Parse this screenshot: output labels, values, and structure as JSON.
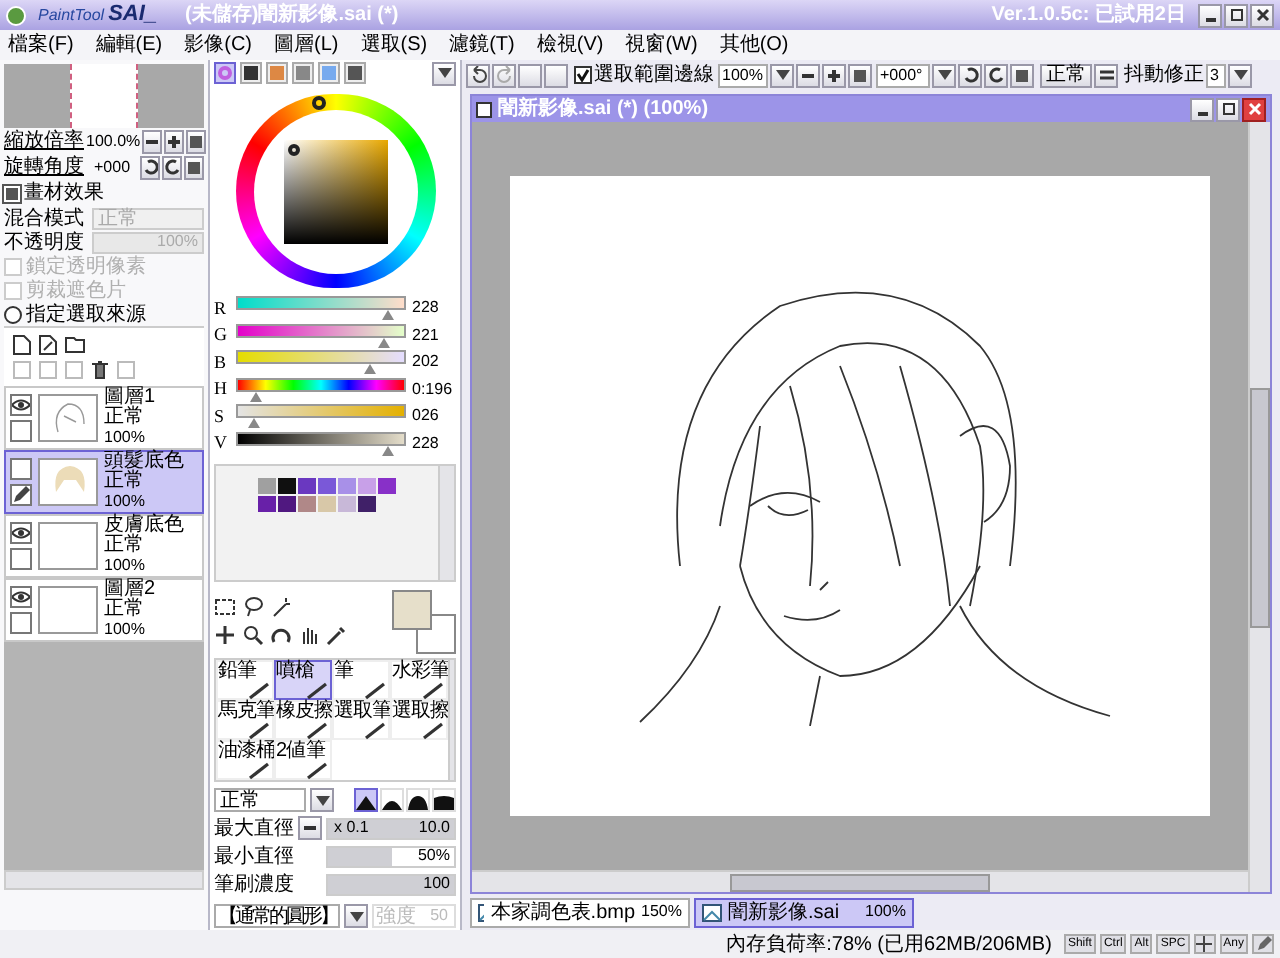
{
  "title_bar": {
    "logo": "PaintTool",
    "logo_mark": "SAI_",
    "title": "(未儲存)闇新影像.sai (*)",
    "version": "Ver.1.0.5c: 已試用2日"
  },
  "menu": [
    "檔案(F)",
    "編輯(E)",
    "影像(C)",
    "圖層(L)",
    "選取(S)",
    "濾鏡(T)",
    "檢視(V)",
    "視窗(W)",
    "其他(O)"
  ],
  "toolbar": {
    "selection_edge": {
      "label": "選取範圍邊線",
      "checked": true
    },
    "zoom": "100%",
    "angle": "+000°",
    "mode": "正常",
    "stabilizer_label": "抖動修正",
    "stabilizer": "3"
  },
  "navigator": {
    "zoom_label": "縮放倍率",
    "zoom": "100.0%",
    "angle_label": "旋轉角度",
    "angle": "+000"
  },
  "layer_properties": {
    "texture_label": "畫材效果",
    "blend_label": "混合模式",
    "blend": "正常",
    "opacity_label": "不透明度",
    "opacity": "100%",
    "options": [
      {
        "label": "鎖定透明像素",
        "kind": "checkbox",
        "checked": false,
        "disabled": true
      },
      {
        "label": "剪裁遮色片",
        "kind": "checkbox",
        "checked": false,
        "disabled": true
      },
      {
        "label": "指定選取來源",
        "kind": "radio",
        "checked": false,
        "disabled": false
      }
    ]
  },
  "layers": [
    {
      "name": "圖層1",
      "mode": "正常",
      "opacity": "100%",
      "visible": true,
      "selected": false
    },
    {
      "name": "頭髮底色",
      "mode": "正常",
      "opacity": "100%",
      "visible": false,
      "selected": true
    },
    {
      "name": "皮膚底色",
      "mode": "正常",
      "opacity": "100%",
      "visible": true,
      "selected": false
    },
    {
      "name": "圖層2",
      "mode": "正常",
      "opacity": "100%",
      "visible": true,
      "selected": false
    }
  ],
  "color_sliders": [
    {
      "label": "R",
      "kind": "r",
      "value": "228",
      "level": 0.89
    },
    {
      "label": "G",
      "kind": "g",
      "value": "221",
      "level": 0.87
    },
    {
      "label": "B",
      "kind": "b",
      "value": "202",
      "level": 0.79
    },
    {
      "label": "H",
      "kind": "h",
      "value": "0:196",
      "level": 0.12
    },
    {
      "label": "S",
      "kind": "s",
      "value": "026",
      "level": 0.1
    },
    {
      "label": "V",
      "kind": "v",
      "value": "228",
      "level": 0.89
    }
  ],
  "swatches": [
    {
      "color": "#a0a0a0"
    },
    {
      "color": "#101010"
    },
    {
      "color": "#6a38c0"
    },
    {
      "color": "#7a58d8"
    },
    {
      "color": "#a890e8"
    },
    {
      "color": "#c8a0e8"
    },
    {
      "color": "#8830c8"
    },
    {
      "color": "#6820a8"
    },
    {
      "color": "#501880"
    },
    {
      "color": "#b08888"
    },
    {
      "color": "#d8c8a8"
    },
    {
      "color": "#c8b8d8"
    },
    {
      "color": "#402068"
    }
  ],
  "tools": [
    {
      "label": "鉛筆",
      "selected": false
    },
    {
      "label": "噴槍",
      "selected": true
    },
    {
      "label": "筆",
      "selected": false
    },
    {
      "label": "水彩筆",
      "selected": false
    },
    {
      "label": "馬克筆",
      "selected": false
    },
    {
      "label": "橡皮擦",
      "selected": false
    },
    {
      "label": "選取筆",
      "selected": false
    },
    {
      "label": "選取擦",
      "selected": false
    },
    {
      "label": "油漆桶",
      "selected": false
    },
    {
      "label": "2値筆",
      "selected": false
    }
  ],
  "brush": {
    "blend": "正常",
    "tips": [
      {
        "selected": true
      },
      {
        "selected": false
      },
      {
        "selected": false
      },
      {
        "selected": false
      }
    ],
    "max_size": {
      "label": "最大直徑",
      "multiplier": "x 0.1",
      "value": "10.0",
      "level": 1
    },
    "min_size": {
      "label": "最小直徑",
      "value": "50%",
      "level": 0.5
    },
    "density": {
      "label": "筆刷濃度",
      "value": "100",
      "level": 1
    },
    "shape": "【通常的圓形】",
    "strength": {
      "label": "強度",
      "value": "50",
      "disabled": true
    }
  },
  "canvas_window": {
    "title": "闇新影像.sai (*) (100%)"
  },
  "document_tabs": [
    {
      "name": "本家調色表.bmp",
      "zoom": "150%",
      "selected": false
    },
    {
      "name": "闇新影像.sai",
      "zoom": "100%",
      "selected": true
    }
  ],
  "status_bar": {
    "memory": "內存負荷率:78% (已用62MB/206MB)",
    "keys": [
      "Shift",
      "Ctrl",
      "Alt",
      "SPC",
      "Any"
    ]
  }
}
